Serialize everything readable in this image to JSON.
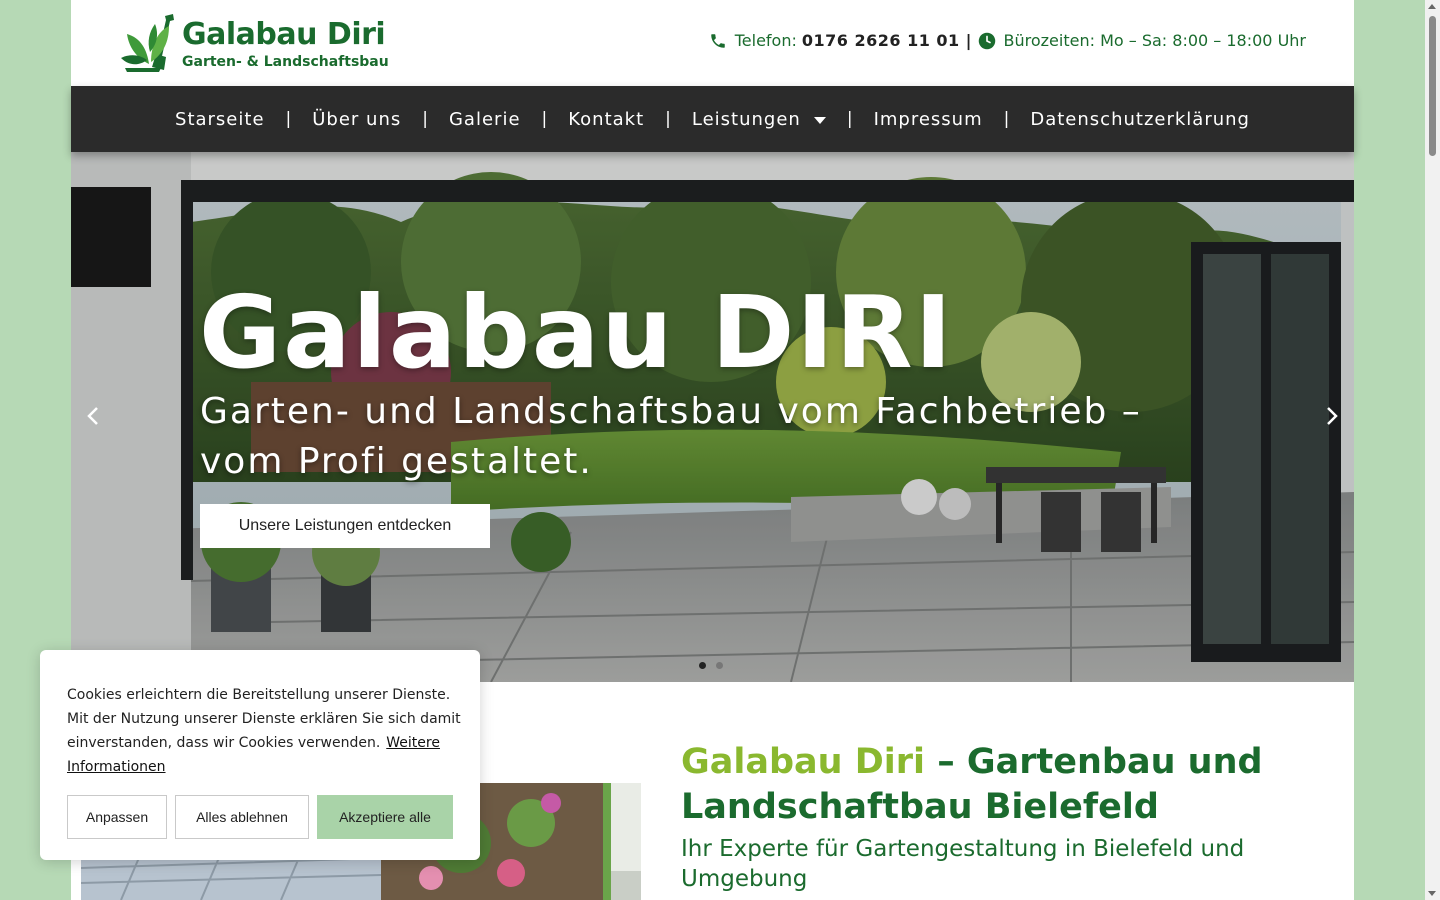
{
  "header": {
    "logo": {
      "title": "Galabau Diri",
      "subtitle": "Garten- & Landschaftsbau",
      "icon": "plant-shovel-icon"
    },
    "contact": {
      "phone_label": "Telefon:",
      "phone_number": "0176 2626 11 01",
      "separator": "|",
      "hours_label": "Bürozeiten: Mo – Sa: 8:00 – 18:00 Uhr"
    }
  },
  "nav": {
    "items": [
      {
        "label": "Starseite"
      },
      {
        "label": "Über uns"
      },
      {
        "label": "Galerie"
      },
      {
        "label": "Kontakt"
      },
      {
        "label": "Leistungen",
        "dropdown": true
      },
      {
        "label": "Impressum"
      },
      {
        "label": "Datenschutzerklärung"
      }
    ],
    "separator": "|"
  },
  "hero": {
    "title": "Galabau DIRI",
    "subtitle": "Garten- und Landschaftsbau vom Fachbetrieb – vom Profi gestaltet.",
    "button_label": "Unsere Leistungen entdecken",
    "slides_total": 2,
    "active_slide": 1
  },
  "section": {
    "heading_icon": "",
    "heading_accent": "Galabau Diri",
    "heading_rest": " – Gartenbau und Landschaftbau Bielefeld",
    "subheading": "Ihr Experte für Gartengestaltung in Bielefeld und Umgebung"
  },
  "cookie": {
    "text": "Cookies erleichtern die Bereitstellung unserer Dienste. Mit der Nutzung unserer Dienste erklären Sie sich damit einverstanden, dass wir Cookies verwenden.",
    "link_label": "Weitere Informationen",
    "buttons": {
      "customize": "Anpassen",
      "reject": "Alles ablehnen",
      "accept": "Akzeptiere alle"
    }
  },
  "colors": {
    "brand_green": "#1a6b2e",
    "accent_green": "#8ab82f",
    "nav_bg": "#2b2b2b",
    "page_bg": "#b6d9b5",
    "accept_btn": "#a9d3a8"
  }
}
